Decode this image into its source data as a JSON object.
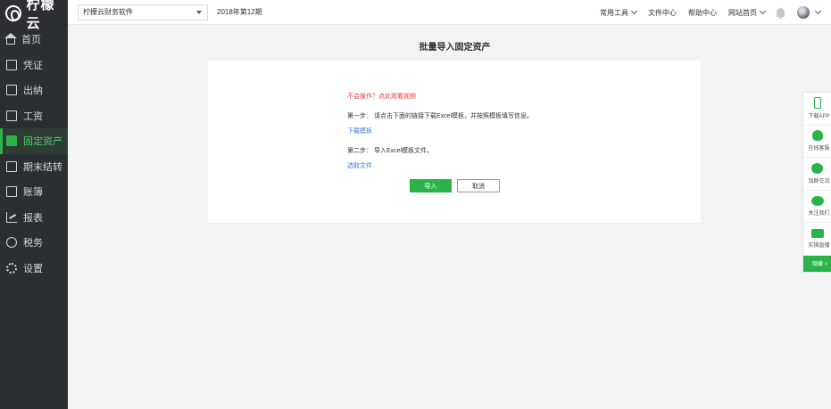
{
  "app": {
    "name": "柠檬云"
  },
  "sidebar": {
    "items": [
      {
        "label": "首页",
        "icon": "home-icon",
        "active": false
      },
      {
        "label": "凭证",
        "icon": "voucher-icon",
        "active": false
      },
      {
        "label": "出纳",
        "icon": "cashier-icon",
        "active": false
      },
      {
        "label": "工资",
        "icon": "salary-icon",
        "active": false
      },
      {
        "label": "固定资产",
        "icon": "fixed-assets-icon",
        "active": true
      },
      {
        "label": "期末结转",
        "icon": "period-end-icon",
        "active": false
      },
      {
        "label": "账簿",
        "icon": "ledger-icon",
        "active": false
      },
      {
        "label": "报表",
        "icon": "report-icon",
        "active": false
      },
      {
        "label": "税务",
        "icon": "tax-icon",
        "active": false
      },
      {
        "label": "设置",
        "icon": "settings-icon",
        "active": false
      }
    ]
  },
  "topbar": {
    "company": "柠檬云财务软件",
    "period": "2018年第12期",
    "links": {
      "tools": "常用工具",
      "files": "文件中心",
      "help": "帮助中心",
      "site": "网站首页"
    }
  },
  "main": {
    "title": "批量导入固定资产",
    "warning": "不会操作？点此观看视频",
    "step1": "第一步： 请点击下面的链接下载Excel模板，并按照模板填写信息。",
    "step1_link": "下载模板",
    "step2": "第二步： 导入Excel模板文件。",
    "step2_link": "选取文件",
    "import_button": "导入",
    "cancel_button": "取消"
  },
  "float_panel": {
    "items": [
      {
        "label": "下载APP",
        "icon": "phone-icon"
      },
      {
        "label": "在线客服",
        "icon": "qq-icon"
      },
      {
        "label": "加群交流",
        "icon": "group-icon"
      },
      {
        "label": "关注我们",
        "icon": "wechat-icon"
      },
      {
        "label": "实操直播",
        "icon": "video-icon"
      }
    ],
    "hide_label": "隐藏 >"
  },
  "colors": {
    "sidebar_bg": "#2b2f33",
    "accent": "#2bb34a",
    "warning": "#e4393c",
    "link": "#3a7bd5"
  }
}
